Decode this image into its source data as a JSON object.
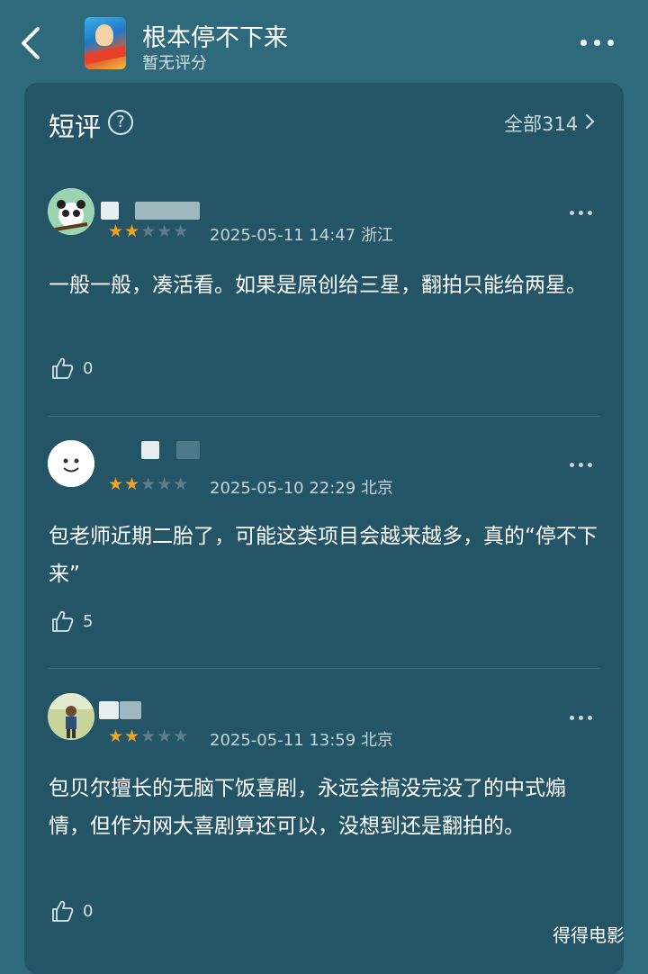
{
  "header": {
    "title": "根本停不下来",
    "subtitle": "暂无评分",
    "back_icon": "chevron-left-icon",
    "more_icon": "more-horizontal-icon"
  },
  "section": {
    "title": "短评",
    "help_icon": "question-circle-icon",
    "all_link": "全部314"
  },
  "reviews": [
    {
      "rating": 2,
      "date": "2025-05-11 14:47",
      "location": "浙江",
      "content": "一般一般，凑活看。如果是原创给三星，翻拍只能给两星。",
      "likes": "0"
    },
    {
      "rating": 2,
      "date": "2025-05-10 22:29",
      "location": "北京",
      "content": "包老师近期二胎了，可能这类项目会越来越多，真的“停不下来”",
      "likes": "5"
    },
    {
      "rating": 2,
      "date": "2025-05-11 13:59",
      "location": "北京",
      "content": "包贝尔擅长的无脑下饭喜剧，永远会搞没完没了的中式煽情，但作为网大喜剧算还可以，没想到还是翻拍的。",
      "likes": "0"
    }
  ],
  "watermark": "得得电影",
  "colors": {
    "background": "#2f6a7c",
    "card": "#245566",
    "star_on": "#f3a11c",
    "star_off": "#5d7e89"
  }
}
